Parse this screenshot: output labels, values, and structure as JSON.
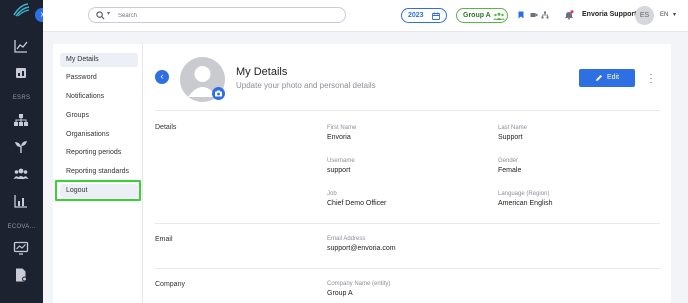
{
  "rail": {
    "esrs_label": "ESRS",
    "ecova_label": "ECOVA..."
  },
  "topbar": {
    "search_placeholder": "Search",
    "year": "2023",
    "group": "Group A",
    "user_name": "Envoria Support",
    "avatar_initials": "ES",
    "language": "EN"
  },
  "settings_nav": {
    "items": [
      {
        "label": "My Details"
      },
      {
        "label": "Password"
      },
      {
        "label": "Notifications"
      },
      {
        "label": "Groups"
      },
      {
        "label": "Organisations"
      },
      {
        "label": "Reporting periods"
      },
      {
        "label": "Reporting standards"
      },
      {
        "label": "Logout"
      }
    ]
  },
  "header": {
    "title": "My Details",
    "subtitle": "Update your photo and personal details",
    "edit_label": "Edit"
  },
  "sections": {
    "details": {
      "label": "Details",
      "first_name_label": "First Name",
      "first_name": "Envoria",
      "last_name_label": "Last Name",
      "last_name": "Support",
      "username_label": "Username",
      "username": "support",
      "gender_label": "Gender",
      "gender": "Female",
      "job_label": "Job",
      "job": "Chief Demo Officer",
      "language_label": "Language (Region)",
      "language": "American English"
    },
    "email": {
      "label": "Email",
      "address_label": "Email Address",
      "address": "support@envoria.com"
    },
    "company": {
      "label": "Company",
      "name_label": "Company Name (entity)",
      "name": "Group A"
    }
  },
  "colors": {
    "accent": "#2f6fe4",
    "rail": "#1d2230",
    "highlight": "#38d236"
  }
}
